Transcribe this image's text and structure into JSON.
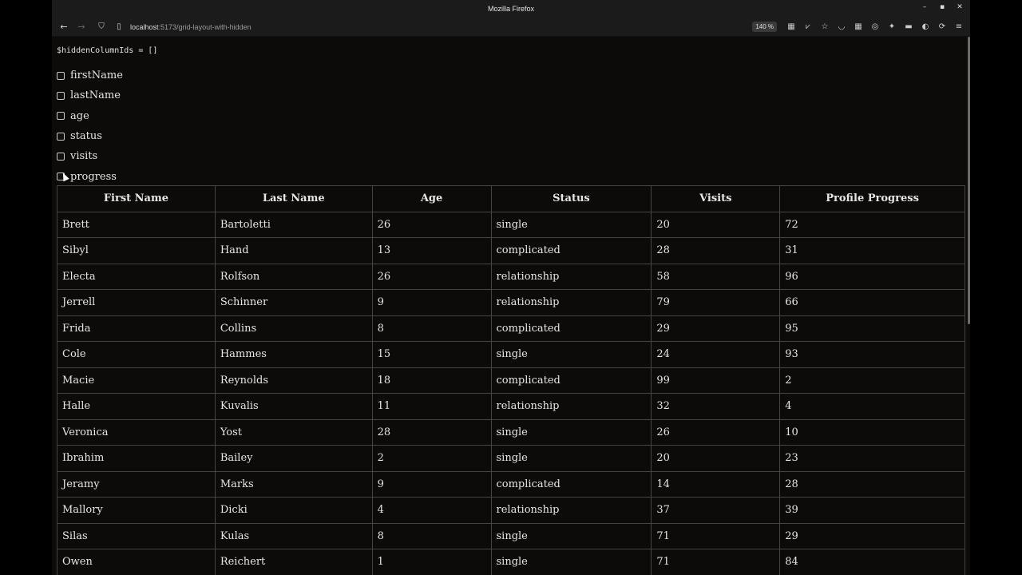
{
  "window": {
    "title": "Mozilla Firefox"
  },
  "nav": {
    "url_host": "localhost",
    "url_path": ":5173/grid-layout-with-hidden",
    "zoom": "140 %"
  },
  "code_line": "$hiddenColumnIds = []",
  "checkboxes": [
    {
      "label": "firstName"
    },
    {
      "label": "lastName"
    },
    {
      "label": "age"
    },
    {
      "label": "status"
    },
    {
      "label": "visits"
    },
    {
      "label": "progress"
    }
  ],
  "table": {
    "headers": [
      "First Name",
      "Last Name",
      "Age",
      "Status",
      "Visits",
      "Profile Progress"
    ],
    "rows": [
      [
        "Brett",
        "Bartoletti",
        "26",
        "single",
        "20",
        "72"
      ],
      [
        "Sibyl",
        "Hand",
        "13",
        "complicated",
        "28",
        "31"
      ],
      [
        "Electa",
        "Rolfson",
        "26",
        "relationship",
        "58",
        "96"
      ],
      [
        "Jerrell",
        "Schinner",
        "9",
        "relationship",
        "79",
        "66"
      ],
      [
        "Frida",
        "Collins",
        "8",
        "complicated",
        "29",
        "95"
      ],
      [
        "Cole",
        "Hammes",
        "15",
        "single",
        "24",
        "93"
      ],
      [
        "Macie",
        "Reynolds",
        "18",
        "complicated",
        "99",
        "2"
      ],
      [
        "Halle",
        "Kuvalis",
        "11",
        "relationship",
        "32",
        "4"
      ],
      [
        "Veronica",
        "Yost",
        "28",
        "single",
        "26",
        "10"
      ],
      [
        "Ibrahim",
        "Bailey",
        "2",
        "single",
        "20",
        "23"
      ],
      [
        "Jeramy",
        "Marks",
        "9",
        "complicated",
        "14",
        "28"
      ],
      [
        "Mallory",
        "Dicki",
        "4",
        "relationship",
        "37",
        "39"
      ],
      [
        "Silas",
        "Kulas",
        "8",
        "single",
        "71",
        "29"
      ],
      [
        "Owen",
        "Reichert",
        "1",
        "single",
        "71",
        "84"
      ]
    ]
  }
}
